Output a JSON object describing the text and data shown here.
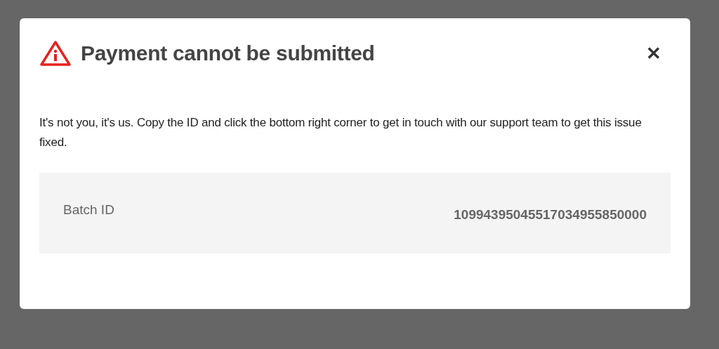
{
  "dialog": {
    "title": "Payment cannot be submitted",
    "close_label": "✕",
    "message": "It's not you, it's us. Copy the ID and click the bottom right corner to get in touch with our support team to get this issue fixed.",
    "field": {
      "label": "Batch ID",
      "value": "10994395045517034955850000"
    }
  }
}
